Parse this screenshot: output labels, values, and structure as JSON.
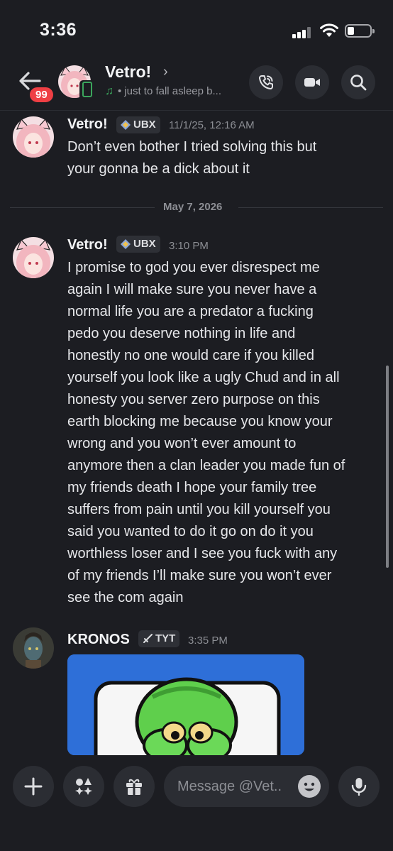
{
  "status_bar": {
    "time": "3:36"
  },
  "header": {
    "title": "Vetro!",
    "unread_count": "99",
    "status_text": "just to fall asleep b..."
  },
  "messages": [
    {
      "author": "Vetro!",
      "tag": "UBX",
      "timestamp": "11/1/25, 12:16 AM",
      "lines": [
        "Don’t even bother I tried solving this but",
        "your gonna be a dick about it"
      ]
    },
    {
      "author": "Vetro!",
      "tag": "UBX",
      "timestamp": "3:10 PM",
      "lines": [
        "I promise to god you ever disrespect me",
        "again I will make sure you never have a",
        "normal life you are a predator a fucking",
        "pedo you deserve nothing in life and",
        "honestly no one would care if you killed",
        "yourself you look like a ugly Chud and in all",
        "honesty you server zero purpose on this",
        "earth blocking me because you know your",
        "wrong and you won’t ever amount to",
        "anymore then a clan leader you made fun of",
        "my friends death I hope your family tree",
        "suffers from pain until you kill yourself you",
        "said you wanted to do it go on do it you",
        "worthless loser and I see you fuck with any",
        "of my friends I’ll make sure you won’t ever",
        "see the com again"
      ]
    },
    {
      "author": "KRONOS",
      "tag": "TYT",
      "timestamp": "3:35 PM"
    }
  ],
  "date_divider": "May 7, 2026",
  "composer": {
    "placeholder": "Message @Vet.."
  },
  "icons": {
    "header": [
      "back-arrow-icon",
      "mobile-status-icon",
      "music-icon",
      "chevron-right-icon",
      "voice-call-icon",
      "video-call-icon",
      "search-icon"
    ],
    "composer": [
      "plus-icon",
      "apps-icon",
      "gift-icon",
      "emoji-icon",
      "microphone-icon"
    ]
  },
  "colors": {
    "background": "#1c1d22",
    "badge": "#ef3f44",
    "online": "#3ba55c",
    "avatar_pink": "#f2b6bf"
  }
}
